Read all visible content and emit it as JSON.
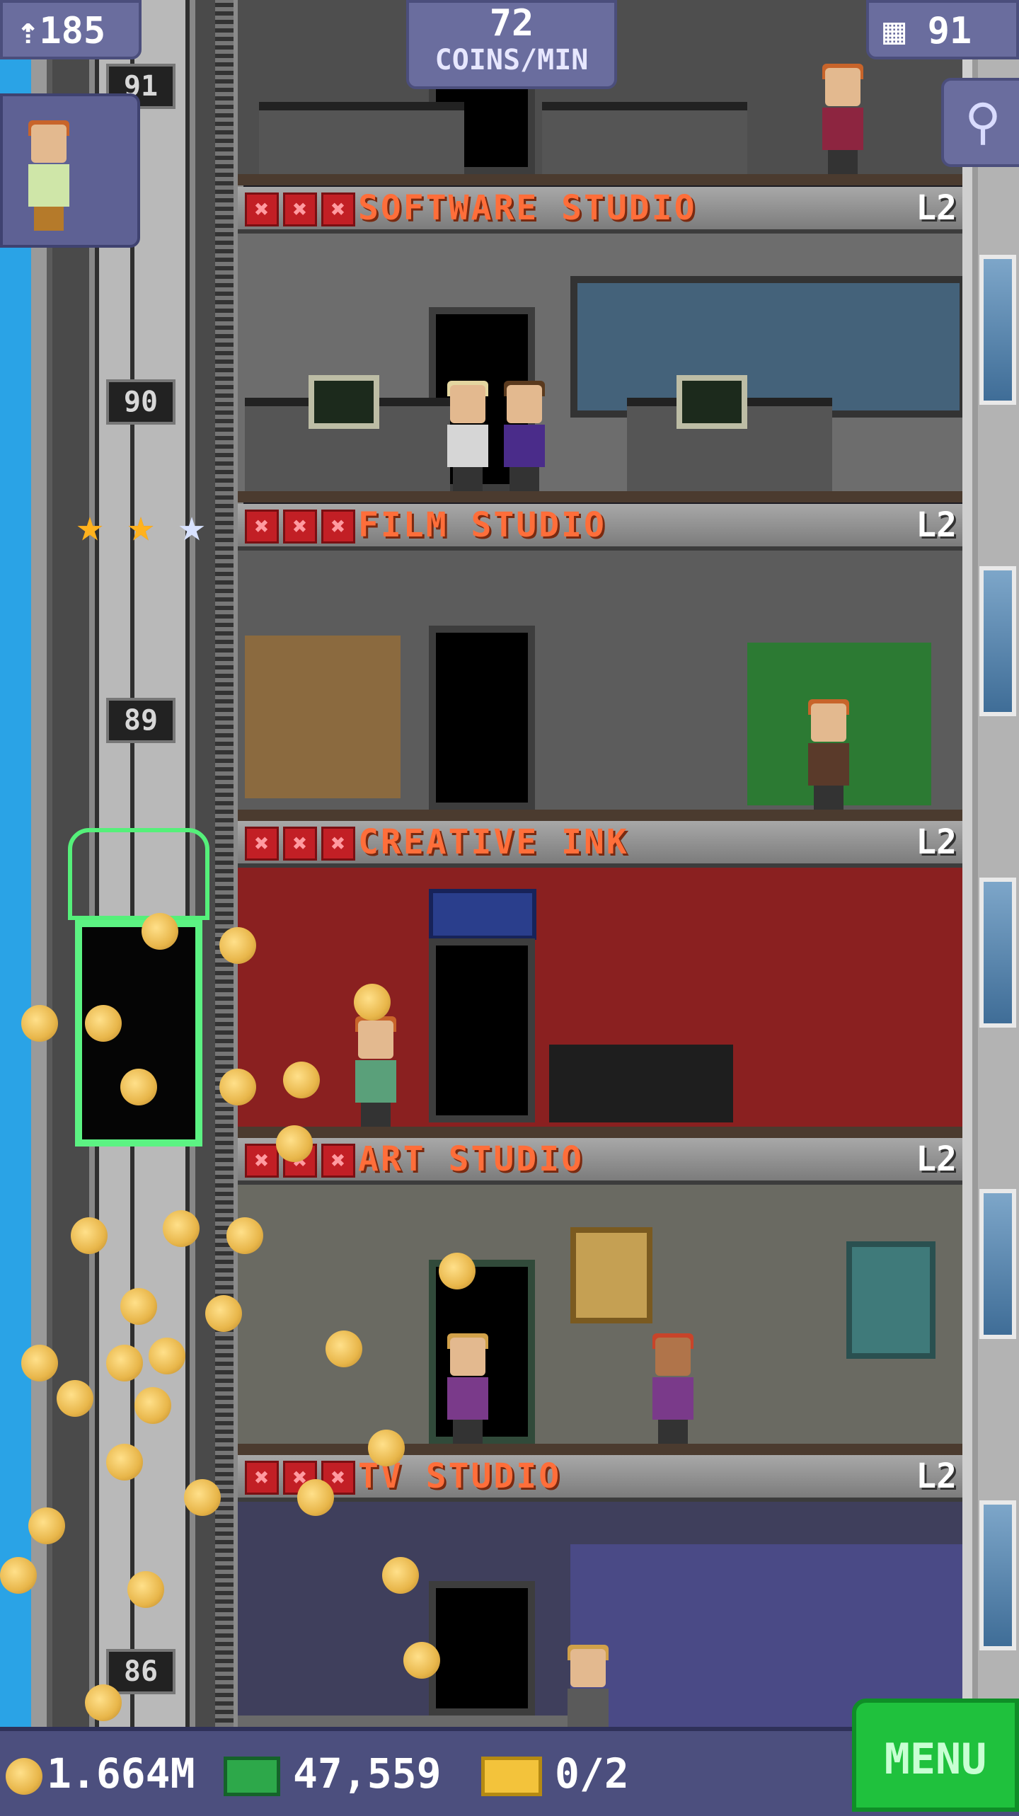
{
  "hud": {
    "population": "185",
    "coins_per_min_value": "72",
    "coins_per_min_label": "COINS/MIN",
    "floors": "91"
  },
  "shaft_numbers": [
    "91",
    "90",
    "89",
    "86"
  ],
  "rooms": [
    {
      "name": "SOFTWARE STUDIO",
      "level": "L2",
      "wall_color": "#6d6d6d"
    },
    {
      "name": "FILM STUDIO",
      "level": "L2",
      "wall_color": "#5c5c5c"
    },
    {
      "name": "CREATIVE INK",
      "level": "L2",
      "wall_color": "#8a2020"
    },
    {
      "name": "ART STUDIO",
      "level": "L2",
      "wall_color": "#6a6a62"
    },
    {
      "name": "TV STUDIO",
      "level": "L2",
      "wall_color": "#3f3f5c"
    }
  ],
  "x_mark_glyph": "✖",
  "star_glyph": "★",
  "stars": {
    "filled": 2,
    "total": 3
  },
  "magnify_glyph": "⚲",
  "bottom": {
    "coins": "1.664M",
    "bux": "47,559",
    "tickets": "0/2",
    "menu_label": "MENU"
  },
  "icons": [
    "people-icon",
    "building-icon",
    "magnify-icon",
    "coin-icon",
    "bux-icon",
    "ticket-icon",
    "star-icon",
    "x-mark-icon"
  ]
}
